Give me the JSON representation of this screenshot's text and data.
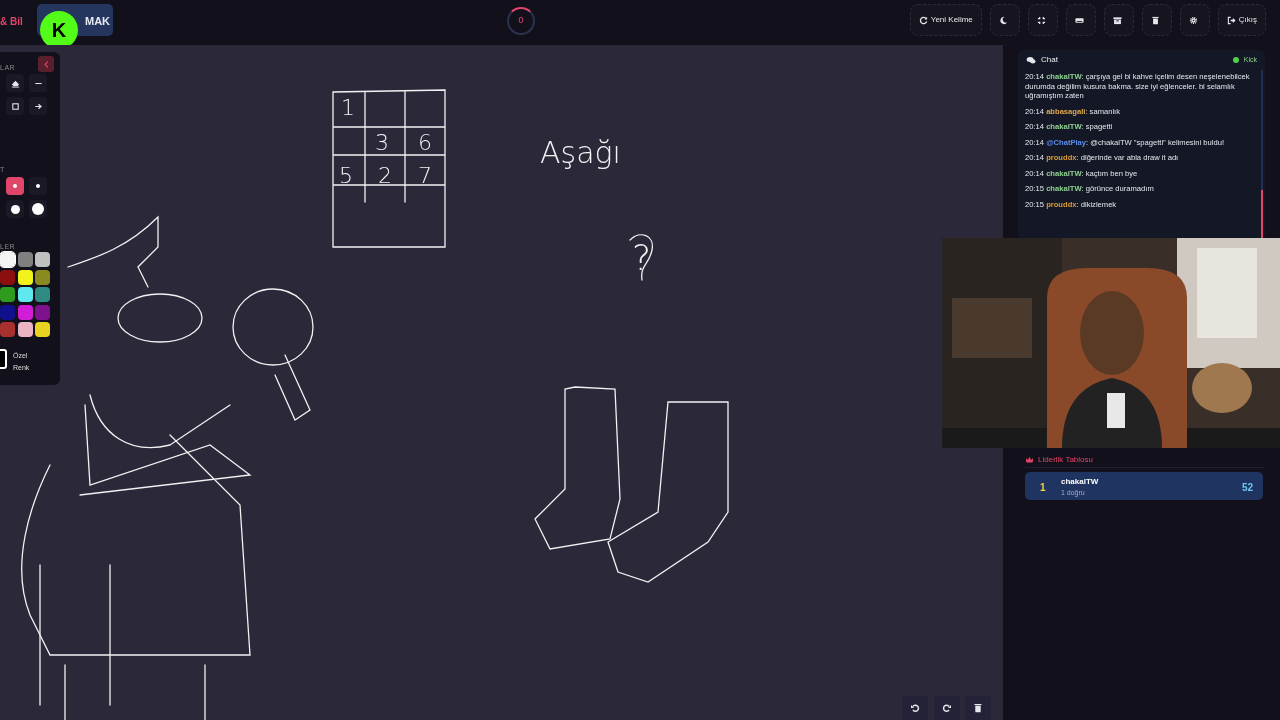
{
  "header": {
    "title_fragment": "& Bil",
    "mode_button": "MAK",
    "logo_letter": "K",
    "counter": "0"
  },
  "toolbar": [
    {
      "kind": "refresh",
      "label": "Yeni Kelime"
    },
    {
      "kind": "moon"
    },
    {
      "kind": "compress"
    },
    {
      "kind": "keyboard"
    },
    {
      "kind": "archive"
    },
    {
      "kind": "trash"
    },
    {
      "kind": "gear"
    },
    {
      "kind": "logout",
      "label": "Çıkış"
    }
  ],
  "tool_panel": {
    "sections": [
      "LAR",
      "T",
      "LER"
    ],
    "tools": [
      {
        "kind": "eraser",
        "selected": false
      },
      {
        "kind": "line",
        "selected": false
      },
      {
        "kind": "square",
        "selected": false
      },
      {
        "kind": "arrow",
        "selected": false
      }
    ],
    "sizes": [
      {
        "kind": "small",
        "selected": true
      },
      {
        "kind": "small",
        "selected": false
      },
      {
        "kind": "large",
        "selected": false
      },
      {
        "kind": "xlarge",
        "selected": false
      }
    ],
    "colors": [
      {
        "color": "#f4f4f4",
        "selected": true
      },
      {
        "color": "#808080",
        "selected": false
      },
      {
        "color": "#c0c0c0",
        "selected": false
      },
      {
        "color": "#8b0f0f",
        "selected": false
      },
      {
        "color": "#f2f21c",
        "selected": false
      },
      {
        "color": "#8a8a1e",
        "selected": false
      },
      {
        "color": "#2e9a1e",
        "selected": false
      },
      {
        "color": "#5fe8ee",
        "selected": false
      },
      {
        "color": "#2f8a84",
        "selected": false
      },
      {
        "color": "#10108c",
        "selected": false
      },
      {
        "color": "#d21cd6",
        "selected": false
      },
      {
        "color": "#7e128c",
        "selected": false
      },
      {
        "color": "#a8302e",
        "selected": false
      },
      {
        "color": "#eab4c2",
        "selected": false
      },
      {
        "color": "#e8d420",
        "selected": false
      }
    ],
    "custom_color": {
      "label": "Özel Renk",
      "color": "#000000"
    }
  },
  "sketch_labels": [
    "1",
    "3",
    "6",
    "5",
    "2",
    "7",
    "Aşağı",
    "?"
  ],
  "canvas_actions": [
    {
      "kind": "undo"
    },
    {
      "kind": "redo"
    },
    {
      "kind": "trash"
    }
  ],
  "chat": {
    "title": "Chat",
    "source": "Kick",
    "messages": [
      {
        "time": "20:14",
        "user": "chakalTW",
        "color": "#8fd18f",
        "text": ": çarşıya gel bi kahve içelim desen neşelenebilcek durumda değilim kusura bakma. size iyi eğlenceler. bi selamlık uğramıştım zaten"
      },
      {
        "time": "20:14",
        "user": "abbasagali",
        "color": "#e0a84a",
        "text": ": samanlık"
      },
      {
        "time": "20:14",
        "user": "chakalTW",
        "color": "#8fd18f",
        "text": ": spagetti"
      },
      {
        "time": "20:14",
        "user": "@ChatPlay",
        "color": "#5b8def",
        "text": ": @chakalTW \"spagetti\" kelimesini buldu!"
      },
      {
        "time": "20:14",
        "user": "prouddx",
        "color": "#d99a3a",
        "text": ": diğerinde var abla draw it adı"
      },
      {
        "time": "20:14",
        "user": "chakalTW",
        "color": "#8fd18f",
        "text": ": kaçtım ben bye"
      },
      {
        "time": "20:15",
        "user": "chakalTW",
        "color": "#8fd18f",
        "text": ": görünce duramadım"
      },
      {
        "time": "20:15",
        "user": "prouddx",
        "color": "#d99a3a",
        "text": ": dikizlemek"
      }
    ]
  },
  "leaderboard": {
    "title": "Liderlik Tablosu",
    "entries": [
      {
        "rank": "1",
        "name": "chakalTW",
        "detail": "1 doğru",
        "score": "52"
      }
    ]
  }
}
